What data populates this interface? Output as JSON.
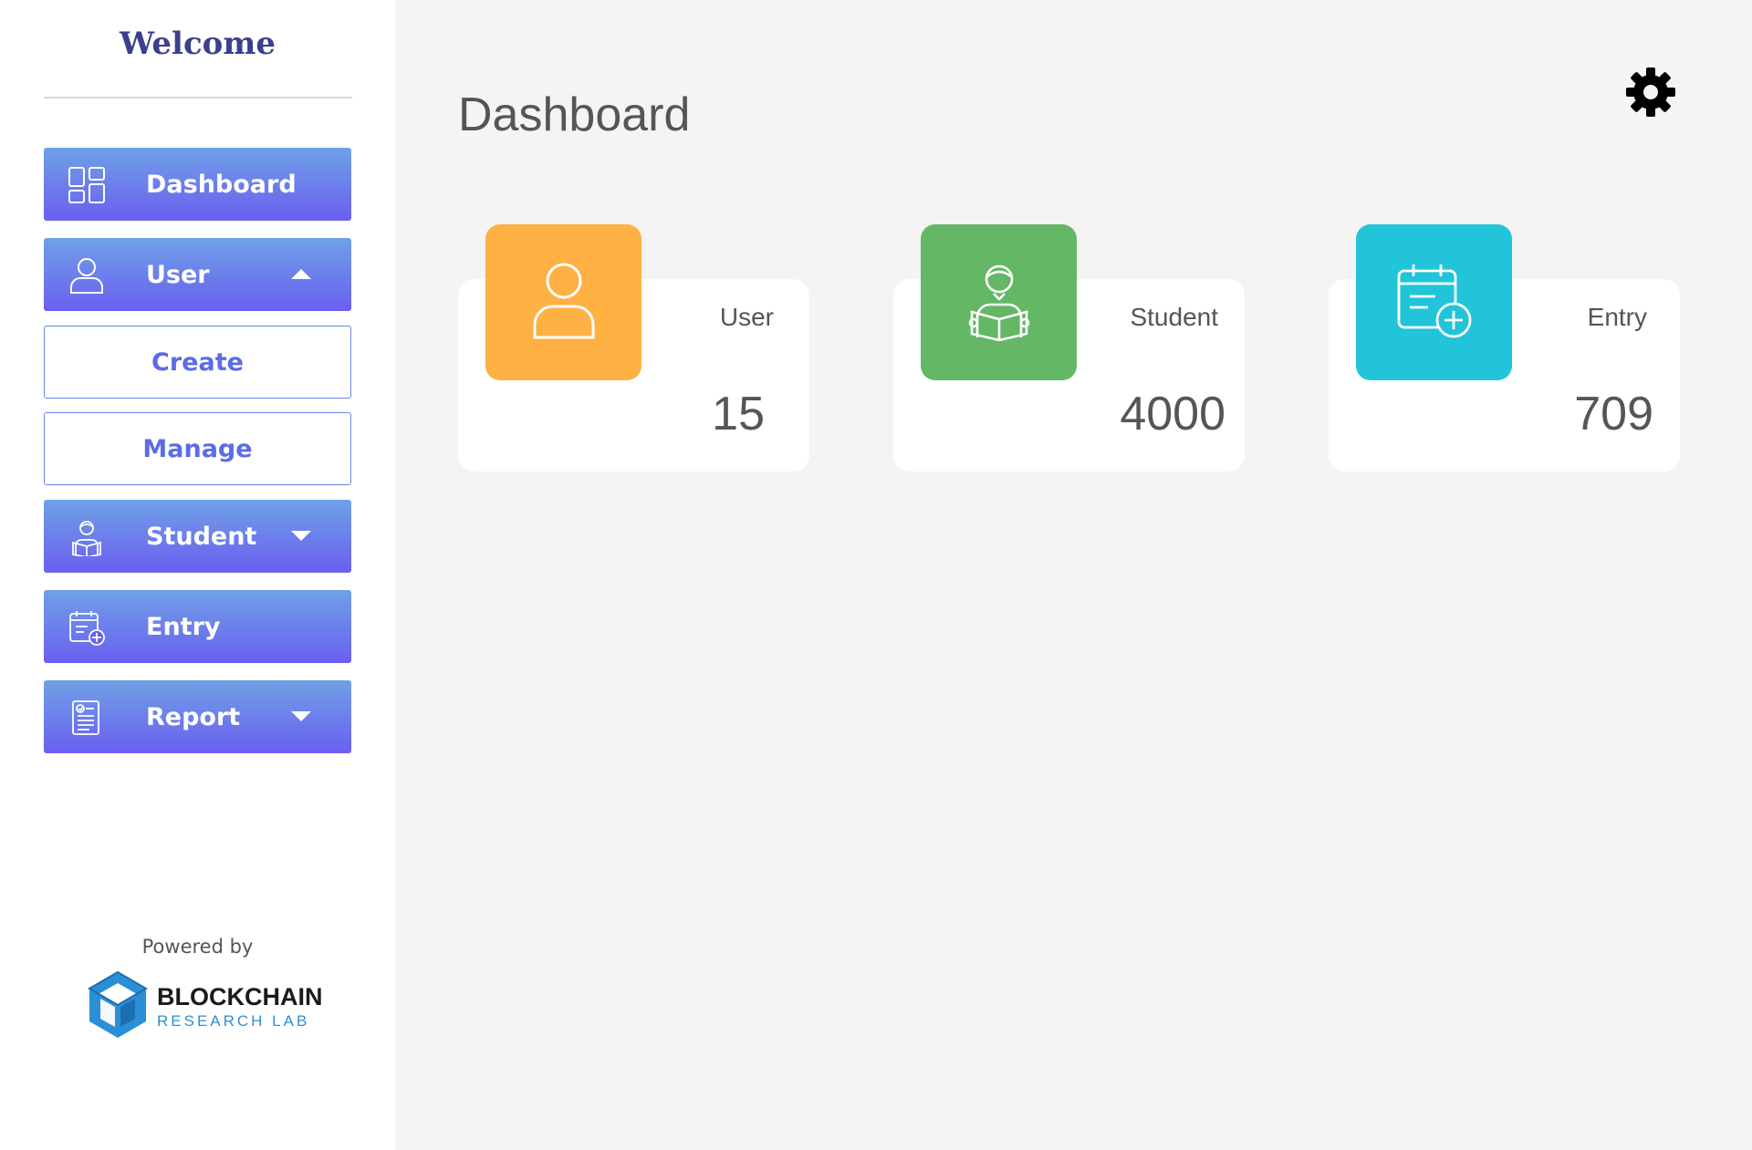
{
  "sidebar": {
    "welcome": "Welcome",
    "nav": {
      "dashboard": "Dashboard",
      "user": "User",
      "user_sub": {
        "create": "Create",
        "manage": "Manage"
      },
      "student": "Student",
      "entry": "Entry",
      "report": "Report"
    },
    "powered_by": "Powered by",
    "logo": {
      "title": "BLOCKCHAIN",
      "subtitle": "RESEARCH LAB"
    }
  },
  "main": {
    "title": "Dashboard",
    "cards": [
      {
        "label": "User",
        "value": "15",
        "icon": "user-icon",
        "color": "#ffb143"
      },
      {
        "label": "Student",
        "value": "4000",
        "icon": "student-reading-icon",
        "color": "#63b765"
      },
      {
        "label": "Entry",
        "value": "709",
        "icon": "calendar-add-icon",
        "color": "#21c4d8"
      }
    ]
  },
  "colors": {
    "nav_gradient_top": "#6fa1e6",
    "nav_gradient_bottom": "#6a5ff0",
    "welcome": "#3b3f8f",
    "background": "#f4f4f4"
  }
}
